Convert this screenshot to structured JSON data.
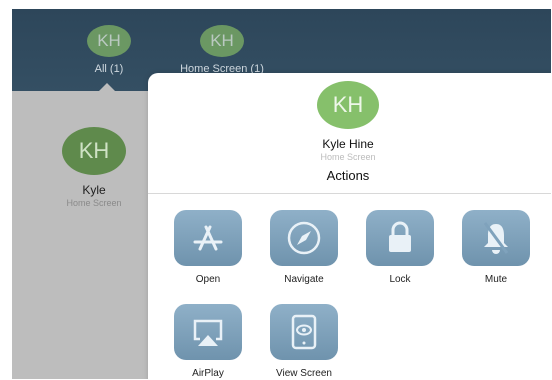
{
  "tabs": [
    {
      "initials": "KH",
      "label": "All (1)"
    },
    {
      "initials": "KH",
      "label": "Home Screen (1)"
    }
  ],
  "background_card": {
    "initials": "KH",
    "name": "Kyle",
    "subtitle": "Home Screen"
  },
  "popover": {
    "initials": "KH",
    "name": "Kyle Hine",
    "subtitle": "Home Screen",
    "section_title": "Actions",
    "actions": [
      {
        "label": "Open",
        "icon": "app-store-icon"
      },
      {
        "label": "Navigate",
        "icon": "compass-icon"
      },
      {
        "label": "Lock",
        "icon": "lock-icon"
      },
      {
        "label": "Mute",
        "icon": "bell-muted-icon"
      },
      {
        "label": "AirPlay",
        "icon": "airplay-icon"
      },
      {
        "label": "View Screen",
        "icon": "view-screen-icon"
      }
    ]
  },
  "colors": {
    "topbar": "#2d465a",
    "avatar": "#86c06b",
    "tile": "#7fa2bc"
  }
}
